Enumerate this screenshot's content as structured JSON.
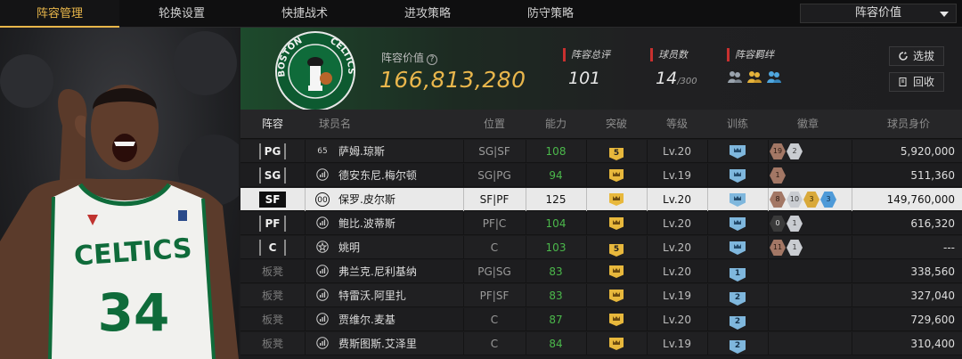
{
  "tabs": [
    "阵容管理",
    "轮换设置",
    "快捷战术",
    "进攻策略",
    "防守策略"
  ],
  "sort_dropdown": "阵容价值",
  "header": {
    "value_label": "阵容价值",
    "value_help": "?",
    "value": "166,813,280",
    "overall_label": "阵容总评",
    "overall": "101",
    "players_label": "球员数",
    "players": "14",
    "players_max": "/300",
    "bond_label": "阵容羁绊",
    "buttons": {
      "select": "选拔",
      "recycle": "回收"
    },
    "team_logo_text": {
      "top": "BOSTON",
      "right": "CELTICS"
    }
  },
  "portrait": {
    "jersey_team": "CELTICS",
    "jersey_number": "34"
  },
  "columns": [
    "阵容",
    "球员名",
    "位置",
    "能力",
    "突破",
    "等级",
    "训练",
    "徽章",
    "球员身价"
  ],
  "rows": [
    {
      "slot": "PG",
      "card": "65",
      "name": "萨姆.琼斯",
      "pos": "SG|SF",
      "ability": "108",
      "green": true,
      "breakthrough": "5",
      "level": "Lv.20",
      "training": "",
      "badges": [
        [
          "bronze",
          "19"
        ],
        [
          "silver",
          "2"
        ]
      ],
      "value": "5,920,000"
    },
    {
      "slot": "SG",
      "card": "bars",
      "name": "德安东尼.梅尔顿",
      "pos": "SG|PG",
      "ability": "94",
      "green": true,
      "breakthrough": "crown",
      "level": "Lv.19",
      "training": "",
      "badges": [
        [
          "bronze",
          "1"
        ]
      ],
      "value": "511,360"
    },
    {
      "slot": "SF",
      "card": "00",
      "name": "保罗.皮尔斯",
      "pos": "SF|PF",
      "ability": "125",
      "green": false,
      "breakthrough": "crown",
      "level": "Lv.20",
      "training": "",
      "badges": [
        [
          "bronze",
          "8"
        ],
        [
          "silver",
          "10"
        ],
        [
          "gold",
          "3"
        ],
        [
          "blue",
          "3"
        ]
      ],
      "value": "149,760,000",
      "selected": true
    },
    {
      "slot": "PF",
      "card": "bars",
      "name": "鲍比.波蒂斯",
      "pos": "PF|C",
      "ability": "104",
      "green": true,
      "breakthrough": "crown",
      "level": "Lv.20",
      "training": "",
      "badges": [
        [
          "dark",
          "0"
        ],
        [
          "silver",
          "1"
        ]
      ],
      "value": "616,320"
    },
    {
      "slot": "C",
      "card": "star",
      "name": "姚明",
      "pos": "C",
      "ability": "103",
      "green": true,
      "breakthrough": "5",
      "level": "Lv.20",
      "training": "",
      "badges": [
        [
          "bronze",
          "11"
        ],
        [
          "silver",
          "1"
        ]
      ],
      "value": "---"
    },
    {
      "slot": "板凳",
      "card": "bars",
      "name": "弗兰克.尼利基纳",
      "pos": "PG|SG",
      "ability": "83",
      "green": true,
      "breakthrough": "crown",
      "level": "Lv.20",
      "training": "1",
      "badges": [],
      "value": "338,560"
    },
    {
      "slot": "板凳",
      "card": "bars",
      "name": "特雷沃.阿里扎",
      "pos": "PF|SF",
      "ability": "83",
      "green": true,
      "breakthrough": "crown",
      "level": "Lv.19",
      "training": "2",
      "badges": [],
      "value": "327,040"
    },
    {
      "slot": "板凳",
      "card": "bars",
      "name": "贾维尔.麦基",
      "pos": "C",
      "ability": "87",
      "green": true,
      "breakthrough": "crown",
      "level": "Lv.20",
      "training": "2",
      "badges": [],
      "value": "729,600"
    },
    {
      "slot": "板凳",
      "card": "bars",
      "name": "费斯图斯.艾泽里",
      "pos": "C",
      "ability": "84",
      "green": true,
      "breakthrough": "crown",
      "level": "Lv.19",
      "training": "2",
      "badges": [],
      "value": "310,400"
    }
  ],
  "colors": {
    "accent": "#e8b64a",
    "ability_green": "#4bb84b",
    "bond_red": "#c8302f"
  }
}
